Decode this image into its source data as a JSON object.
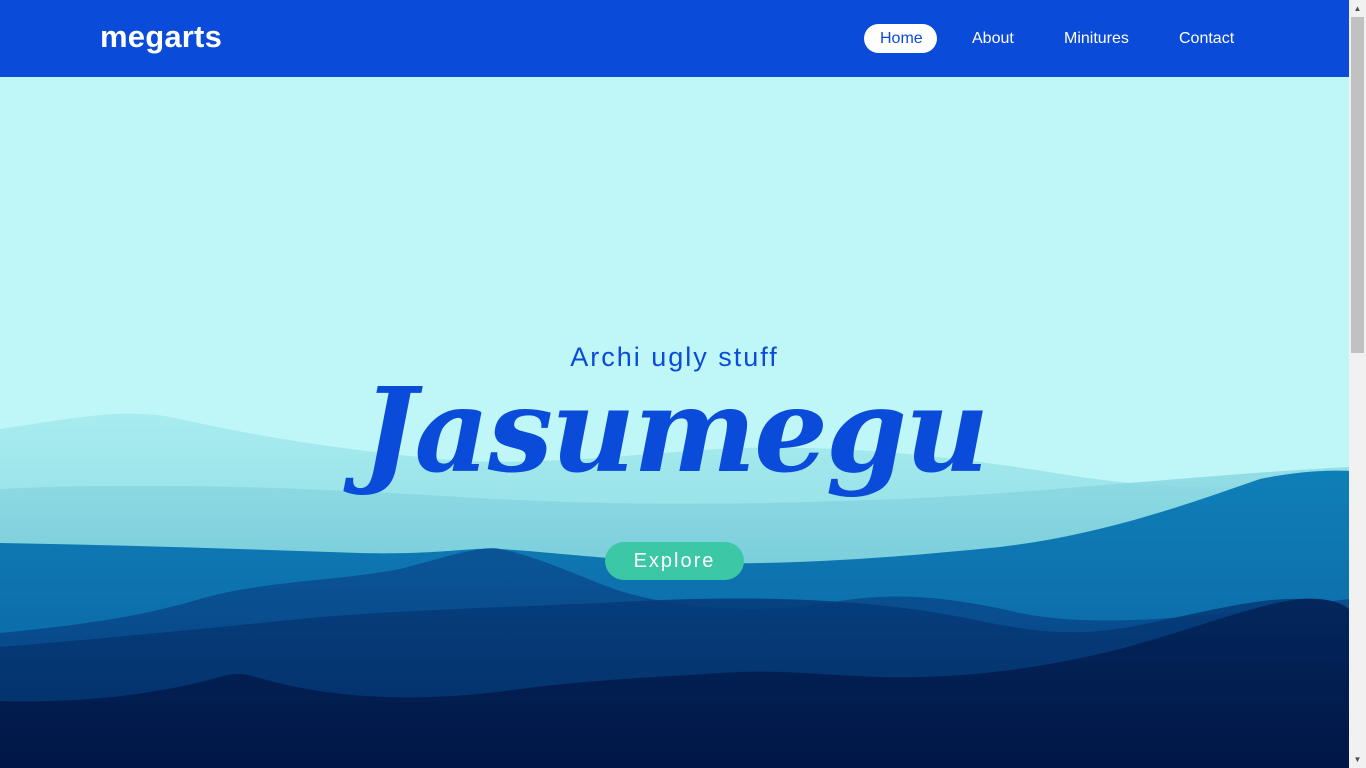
{
  "navbar": {
    "brand": "megarts",
    "links": [
      {
        "label": "Home",
        "active": true
      },
      {
        "label": "About",
        "active": false
      },
      {
        "label": "Minitures",
        "active": false
      },
      {
        "label": "Contact",
        "active": false
      }
    ]
  },
  "hero": {
    "subtitle": "Archi ugly stuff",
    "headline": "Jasumegu",
    "cta_label": "Explore"
  },
  "colors": {
    "primary": "#0a4bd9",
    "sky": "#bff6f7",
    "accent": "#3cc7a6",
    "mountain_dark": "#021c4d"
  },
  "icons": {
    "scroll_up": "triangle-up-icon",
    "scroll_down": "triangle-down-icon"
  }
}
